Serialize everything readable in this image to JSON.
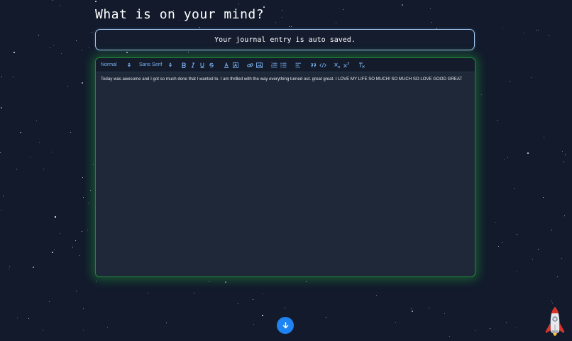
{
  "page": {
    "title": "What is on your mind?"
  },
  "banner": {
    "text": "Your journal entry is auto saved."
  },
  "toolbar": {
    "header_select": "Normal",
    "font_select": "Sans Serif",
    "buttons": [
      {
        "name": "bold-icon",
        "glyph": "B"
      },
      {
        "name": "italic-icon",
        "glyph": "I"
      },
      {
        "name": "underline-icon",
        "glyph": "U"
      },
      {
        "name": "strike-icon",
        "glyph": "S"
      },
      {
        "name": "text-color-icon",
        "glyph": "A"
      },
      {
        "name": "background-color-icon",
        "glyph": "A"
      },
      {
        "name": "link-icon",
        "glyph": "link"
      },
      {
        "name": "image-icon",
        "glyph": "image"
      },
      {
        "name": "ordered-list-icon",
        "glyph": "ol"
      },
      {
        "name": "bullet-list-icon",
        "glyph": "ul"
      },
      {
        "name": "align-icon",
        "glyph": "align"
      },
      {
        "name": "blockquote-icon",
        "glyph": "”"
      },
      {
        "name": "code-block-icon",
        "glyph": "</>"
      },
      {
        "name": "subscript-icon",
        "glyph": "x₂"
      },
      {
        "name": "superscript-icon",
        "glyph": "x²"
      },
      {
        "name": "clear-format-icon",
        "glyph": "Tx"
      }
    ]
  },
  "editor": {
    "content": "Today was awesome and I got so much done that I wanted to. I am thrilled with the way everything turned out. great great. I LOVE MY LIFE SO MUCH! SO MUCH SO LOVE GOOD GREAT"
  },
  "colors": {
    "background": "#121a2c",
    "banner_border": "#9fc5ef",
    "editor_glow": "#22863a",
    "accent": "#1e82f0",
    "toolbar_icon": "#7ab0ef"
  },
  "icons": {
    "scroll_down": "arrow-down-icon",
    "mascot": "rocket-icon"
  }
}
